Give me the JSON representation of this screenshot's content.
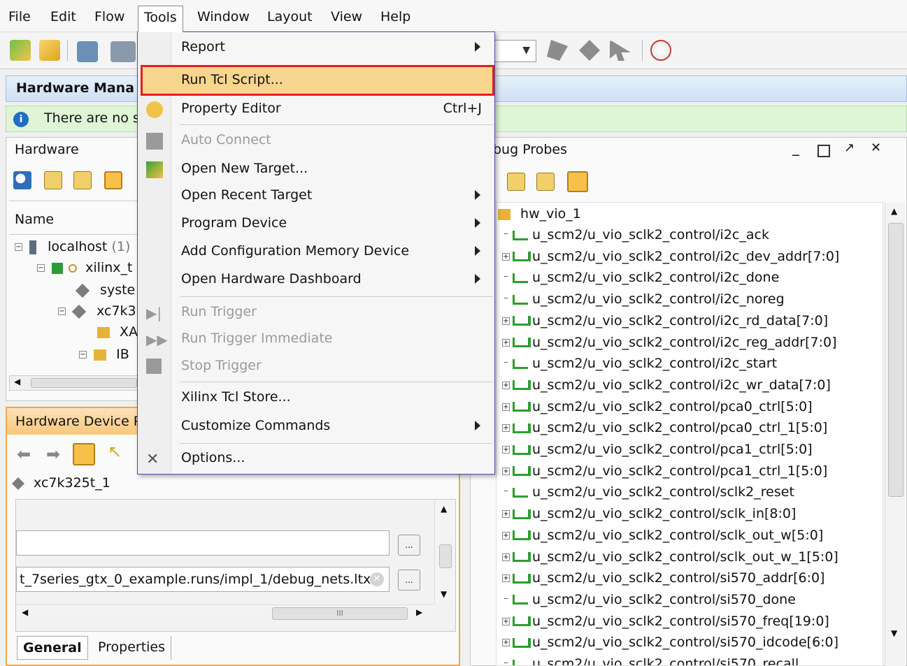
{
  "menubar": {
    "items": [
      "File",
      "Edit",
      "Flow",
      "Tools",
      "Window",
      "Layout",
      "View",
      "Help"
    ]
  },
  "hardware_manager": {
    "title": "Hardware Mana",
    "info_text": "There are no s"
  },
  "hardware_panel": {
    "title": "Hardware",
    "column_name": "Name",
    "tree": [
      {
        "label": "localhost",
        "suffix": "(1)"
      },
      {
        "label": "xilinx_t"
      },
      {
        "label": "syste"
      },
      {
        "label": "xc7k3"
      },
      {
        "label": "XA"
      },
      {
        "label": "IB"
      }
    ]
  },
  "device_panel": {
    "title": "Hardware Device P",
    "device": "xc7k325t_1",
    "probes_file": "t_7series_gtx_0_example.runs/impl_1/debug_nets.ltx",
    "browse_label": "...",
    "tabs": [
      "General",
      "Properties"
    ],
    "scroll_marker": "III"
  },
  "probes_panel": {
    "title": "bug Probes",
    "root": "hw_vio_1",
    "signals": [
      {
        "name": "u_scm2/u_vio_sclk2_control/i2c_ack",
        "expandable": false,
        "bus": false
      },
      {
        "name": "u_scm2/u_vio_sclk2_control/i2c_dev_addr[7:0]",
        "expandable": true,
        "bus": true
      },
      {
        "name": "u_scm2/u_vio_sclk2_control/i2c_done",
        "expandable": false,
        "bus": false
      },
      {
        "name": "u_scm2/u_vio_sclk2_control/i2c_noreg",
        "expandable": false,
        "bus": false
      },
      {
        "name": "u_scm2/u_vio_sclk2_control/i2c_rd_data[7:0]",
        "expandable": true,
        "bus": true
      },
      {
        "name": "u_scm2/u_vio_sclk2_control/i2c_reg_addr[7:0]",
        "expandable": true,
        "bus": true
      },
      {
        "name": "u_scm2/u_vio_sclk2_control/i2c_start",
        "expandable": false,
        "bus": false
      },
      {
        "name": "u_scm2/u_vio_sclk2_control/i2c_wr_data[7:0]",
        "expandable": true,
        "bus": true
      },
      {
        "name": "u_scm2/u_vio_sclk2_control/pca0_ctrl[5:0]",
        "expandable": true,
        "bus": true
      },
      {
        "name": "u_scm2/u_vio_sclk2_control/pca0_ctrl_1[5:0]",
        "expandable": true,
        "bus": true
      },
      {
        "name": "u_scm2/u_vio_sclk2_control/pca1_ctrl[5:0]",
        "expandable": true,
        "bus": true
      },
      {
        "name": "u_scm2/u_vio_sclk2_control/pca1_ctrl_1[5:0]",
        "expandable": true,
        "bus": true
      },
      {
        "name": "u_scm2/u_vio_sclk2_control/sclk2_reset",
        "expandable": false,
        "bus": false
      },
      {
        "name": "u_scm2/u_vio_sclk2_control/sclk_in[8:0]",
        "expandable": true,
        "bus": true
      },
      {
        "name": "u_scm2/u_vio_sclk2_control/sclk_out_w[5:0]",
        "expandable": true,
        "bus": true
      },
      {
        "name": "u_scm2/u_vio_sclk2_control/sclk_out_w_1[5:0]",
        "expandable": true,
        "bus": true
      },
      {
        "name": "u_scm2/u_vio_sclk2_control/si570_addr[6:0]",
        "expandable": true,
        "bus": true
      },
      {
        "name": "u_scm2/u_vio_sclk2_control/si570_done",
        "expandable": false,
        "bus": false
      },
      {
        "name": "u_scm2/u_vio_sclk2_control/si570_freq[19:0]",
        "expandable": true,
        "bus": true
      },
      {
        "name": "u_scm2/u_vio_sclk2_control/si570_idcode[6:0]",
        "expandable": true,
        "bus": true
      },
      {
        "name": "u_scm2/u_vio_sclk2_control/si570_recall",
        "expandable": false,
        "bus": false
      }
    ]
  },
  "tools_menu": {
    "items": [
      {
        "label": "Report",
        "submenu": true,
        "disabled": false
      },
      {
        "label": "Run Tcl Script...",
        "submenu": false,
        "disabled": false,
        "highlighted": true
      },
      {
        "label": "Property Editor",
        "shortcut": "Ctrl+J",
        "disabled": false
      },
      {
        "label": "Auto Connect",
        "disabled": true
      },
      {
        "label": "Open New Target...",
        "disabled": false
      },
      {
        "label": "Open Recent Target",
        "submenu": true,
        "disabled": false
      },
      {
        "label": "Program Device",
        "submenu": true,
        "disabled": false
      },
      {
        "label": "Add Configuration Memory Device",
        "submenu": true,
        "disabled": false
      },
      {
        "label": "Open Hardware Dashboard",
        "submenu": true,
        "disabled": false
      },
      {
        "label": "Run Trigger",
        "disabled": true
      },
      {
        "label": "Run Trigger Immediate",
        "disabled": true
      },
      {
        "label": "Stop Trigger",
        "disabled": true
      },
      {
        "label": "Xilinx Tcl Store...",
        "disabled": false
      },
      {
        "label": "Customize Commands",
        "submenu": true,
        "disabled": false
      },
      {
        "label": "Options...",
        "disabled": false
      }
    ]
  },
  "colors": {
    "highlight_fill": "#f8d58e",
    "highlight_border": "#e02020",
    "menu_border": "#4c4ca8",
    "info_bar": "#dff5d6",
    "bus_icon": "#2e9d2e"
  }
}
